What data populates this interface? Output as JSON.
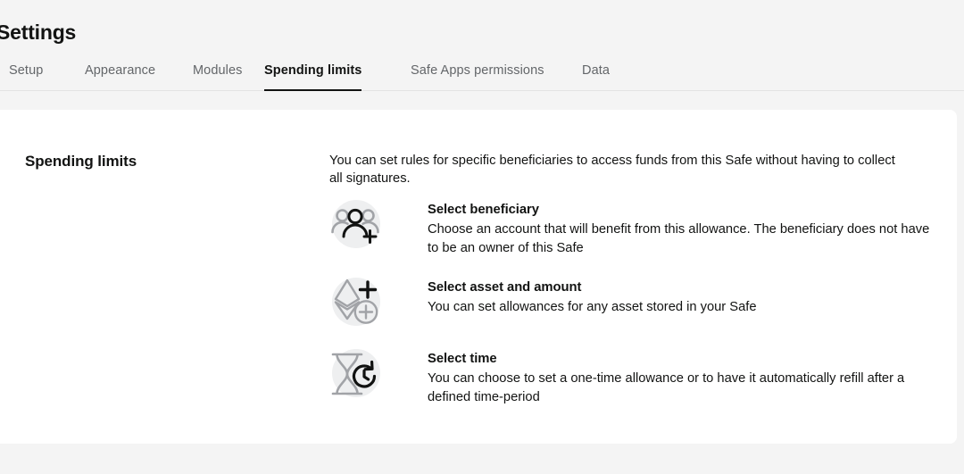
{
  "header": {
    "title": "Settings"
  },
  "tabs": [
    {
      "label": "Setup",
      "active": false
    },
    {
      "label": "Appearance",
      "active": false
    },
    {
      "label": "Modules",
      "active": false
    },
    {
      "label": "Spending limits",
      "active": true
    },
    {
      "label": "Safe Apps permissions",
      "active": false
    },
    {
      "label": "Data",
      "active": false
    }
  ],
  "main": {
    "section_title": "Spending limits",
    "intro": "You can set rules for specific beneficiaries to access funds from this Safe without having to collect all signatures.",
    "features": [
      {
        "icon": "people-add-icon",
        "title": "Select beneficiary",
        "description": "Choose an account that will benefit from this allowance. The beneficiary does not have to be an owner of this Safe"
      },
      {
        "icon": "ethereum-add-icon",
        "title": "Select asset and amount",
        "description": "You can set allowances for any asset stored in your Safe"
      },
      {
        "icon": "hourglass-refresh-icon",
        "title": "Select time",
        "description": "You can choose to set a one-time allowance or to have it automatically refill after a defined time-period"
      }
    ]
  },
  "colors": {
    "page_background": "#f4f4f4",
    "card_background": "#ffffff",
    "text_primary": "#121312",
    "text_muted": "#636669",
    "icon_disc": "#eeeff0",
    "icon_gray": "#a1a3a7",
    "icon_dark": "#121312",
    "divider": "#e3e3e3"
  }
}
